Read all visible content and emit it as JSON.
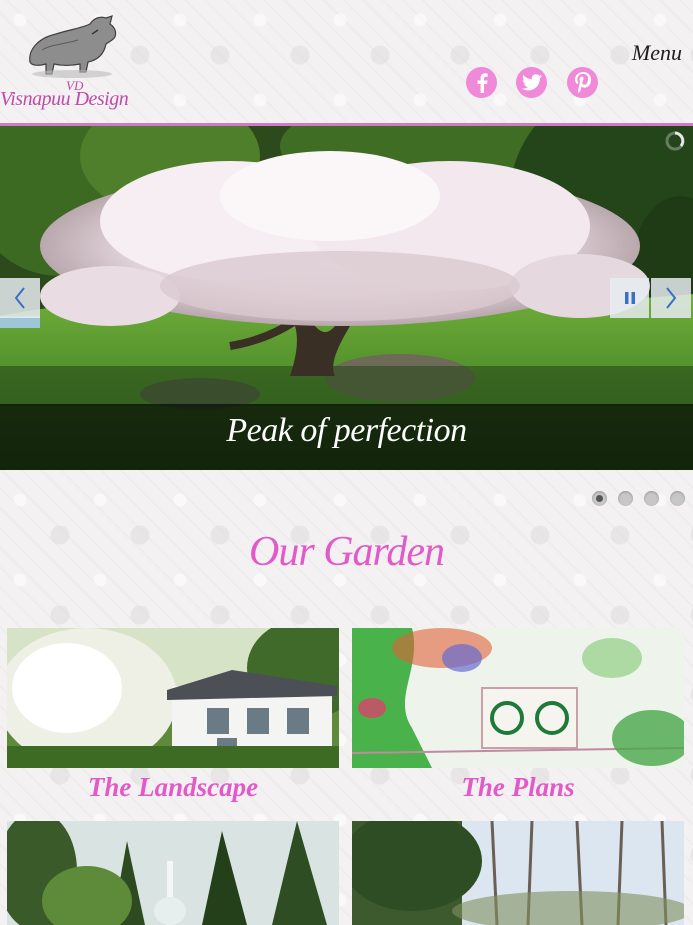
{
  "header": {
    "logo_mark": "VD",
    "logo_text": "Visnapuu Design",
    "menu_label": "Menu",
    "social": [
      "facebook-icon",
      "twitter-icon",
      "pinterest-icon"
    ],
    "accent_color": "#f08ad8"
  },
  "slider": {
    "caption": "Peak of perfection",
    "slide_count": 4,
    "active_slide": 1
  },
  "section": {
    "title": "Our Garden",
    "title_color": "#e25ac9"
  },
  "cards": [
    {
      "label": "The Landscape"
    },
    {
      "label": "The Plans"
    },
    {
      "label": ""
    },
    {
      "label": ""
    }
  ]
}
